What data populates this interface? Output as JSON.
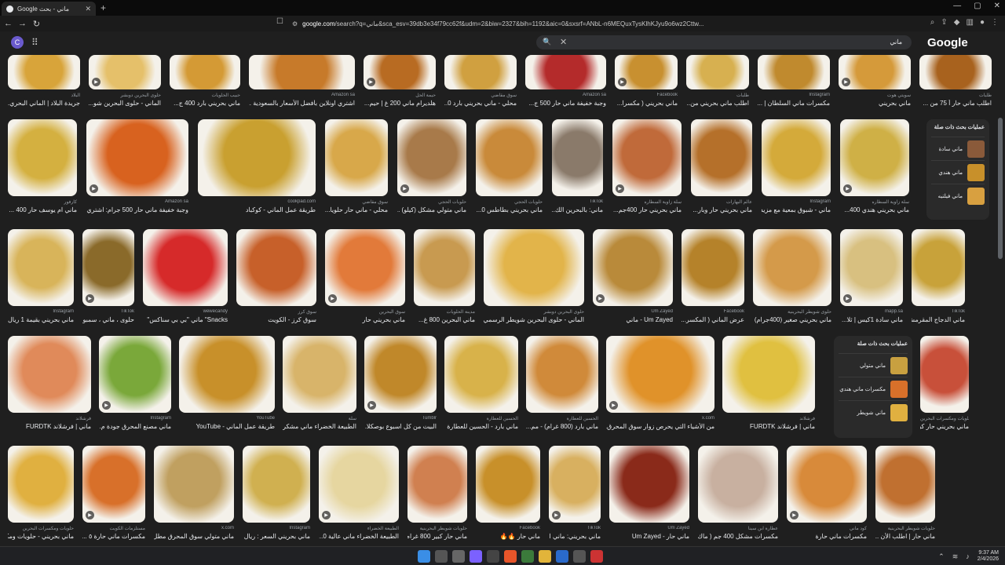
{
  "browser": {
    "tab_title": "ماني - بحث Google",
    "url_host": "google.com",
    "url_rest": "/search?q=ماني&sca_esv=39db3e34f79cc62f&udm=2&biw=2327&bih=1192&aic=0&sxsrf=ANbL-n6MEQuxTysKlhKJyu9o6wz2Cttw..."
  },
  "google": {
    "avatar_letter": "C",
    "query": "ماني",
    "logo_text": "Google"
  },
  "rows": [
    [
      {
        "title": "جريدة البلاد | الماني البحري...",
        "source": "البلاد",
        "color": "#d8a43a"
      },
      {
        "title": "الماني - حلوى البحرين شو...",
        "source": "حلوى البحرين دوبشر",
        "color": "#e5c06a"
      },
      {
        "title": "ماني بحريني بارد 400 ج...",
        "source": "حبيب الحلويات",
        "color": "#d49a35"
      },
      {
        "title": "اشتري اونلاين بأفضل الأسعار بالسعودية ...",
        "source": "Amazon sa",
        "color": "#c77a2a"
      },
      {
        "title": "هلديرام ماني 200 غ | حيم...",
        "source": "حيمة الحل",
        "color": "#b86b22"
      },
      {
        "title": "محلي - ماني بحريني بارد 0...",
        "source": "سوق مقاضي",
        "color": "#d0a040"
      },
      {
        "title": "وجبة خفيفة ماني حار 500 ج...",
        "source": "Amazon sa",
        "color": "#b42b2b"
      },
      {
        "title": "ماني بحريني ( مكسرا...",
        "source": "Facebook",
        "color": "#c89030"
      },
      {
        "title": "اطلب ماني بحريني من...",
        "source": "طلبات",
        "color": "#d7b050"
      },
      {
        "title": "مكسرات ماني السلطان | ...",
        "source": "Instagram",
        "color": "#c08a2e"
      },
      {
        "title": "ماني بحريني",
        "source": "سويتي هوت",
        "color": "#d59a3a"
      },
      {
        "title": "اطلب ماني حار أ 75 من ...",
        "source": "طلبات",
        "color": "#a8621e"
      }
    ],
    [
      {
        "title": "ماني ام يوسف حار 400 ...",
        "source": "كارفور",
        "color": "#d4b040"
      },
      {
        "title": "وجبة خفيفة ماني حار 500 جرام: اشتري...",
        "source": "Amazon sa",
        "color": "#d8621f"
      },
      {
        "title": "طريقة عمل الماني - كوكباد",
        "source": "cookpad.com",
        "color": "#c9a030"
      },
      {
        "title": "محلي - ماني حار حلويا...",
        "source": "سوق مقاضي",
        "color": "#d8a84a"
      },
      {
        "title": "ماني متولي مشكل (كيلو) ...",
        "source": "حلويات الحجي",
        "color": "#a87a4a"
      },
      {
        "title": "ماني بحريني بطاطس 0...",
        "source": "حلويات الحجي",
        "color": "#c98a3a"
      },
      {
        "title": "ماني: بالبحرين الك...",
        "source": "TikTok",
        "color": "#8a7a6a"
      },
      {
        "title": "ماني بحريني حار 400جم...",
        "source": "سلة زاوية السطاره",
        "color": "#c06a3a"
      },
      {
        "title": "ماني بحريني حار وبار...",
        "source": "عالم البهارات",
        "color": "#b5702a"
      },
      {
        "title": "ماني - شبوق بمعية مع مزيد",
        "source": "Instagram",
        "color": "#d4aa3a"
      },
      {
        "title": "ماني بحريني هندي 400...",
        "source": "سلة زاوية السطاره",
        "color": "#cfb046"
      }
    ],
    [
      {
        "title": "ماني بحريني بقيمة 1 ريال",
        "source": "Instagram",
        "color": "#d8b45a"
      },
      {
        "title": "حلوى ، ماني ، سمبوس...",
        "source": "TikTok",
        "color": "#8a6a2a"
      },
      {
        "title": "Snacks\" ماني \"بي بي سناكس\"",
        "source": "wewecandy",
        "color": "#d62a2a"
      },
      {
        "title": "سوق كرز - الكويت",
        "source": "سوق كرز",
        "color": "#c7602a"
      },
      {
        "title": "ماني بحريني حار",
        "source": "سوق البحرين",
        "color": "#e27a3a"
      },
      {
        "title": "ماني البحرين 800 غ...",
        "source": "مدينة الحلويات",
        "color": "#c89a50"
      },
      {
        "title": "الماني - حلوى البحرين شويطر الرسمي",
        "source": "حلوى البحرين دوبشر",
        "color": "#e2b44a"
      },
      {
        "title": "Um Zayed - ماني",
        "source": "Um Zayed",
        "color": "#b98a3a"
      },
      {
        "title": "عرض الماني ( المكسر...",
        "source": "Facebook",
        "color": "#b5822a"
      },
      {
        "title": "ماني بحريني صغير (400جرام)",
        "source": "حلوى شويطر البحرينية",
        "color": "#d49a4a"
      },
      {
        "title": "ماني سادة 1كيس | ثلا...",
        "source": "mapp.sa",
        "color": "#d8c080"
      },
      {
        "title": "ماني الدجاج المقرمش 1...",
        "source": "TikTok",
        "color": "#c8a23a"
      }
    ],
    [
      {
        "title": "ماني | فرشلاند FURDTK",
        "source": "فرشلاند",
        "color": "#e08a5a"
      },
      {
        "title": "ماني مصنع المحرق جودة م...",
        "source": "Instagram",
        "color": "#7aa83a"
      },
      {
        "title": "طريقة عمل الماني - YouTube",
        "source": "YouTube",
        "color": "#c8902a"
      },
      {
        "title": "الطبيعة الخضراء ماني مشكر...",
        "source": "سلة",
        "color": "#d8b46a"
      },
      {
        "title": "البيت من كل اسبوع بوصكلا...",
        "source": "Tumblr",
        "color": "#c0882a"
      },
      {
        "title": "ماني بارد - الحسين للعطارة",
        "source": "الحسين للعطارة",
        "color": "#d8b24a"
      },
      {
        "title": "ماني بارد (800 غرام) - مم...",
        "source": "الحسين للعطارة",
        "color": "#d08a3a"
      },
      {
        "title": "من الأشياء التي يحرص زوار سوق المحرق...",
        "source": "x.com",
        "color": "#e0922a"
      },
      {
        "title": "ماني | فرشلاند FURDTK",
        "source": "فرشلاند",
        "color": "#e0c040"
      },
      {
        "title": "ماني بحريني حار كبير م...",
        "source": "حلويات ومكسرات البحرين",
        "color": "#c8503a"
      }
    ],
    [
      {
        "title": "ماني بحريني - حلويات ومكسرا...",
        "source": "حلويات ومكسرات البحرين",
        "color": "#e0b040"
      },
      {
        "title": "مكسرات ماني حارة ٥ ...",
        "source": "مستلزمات الكويت",
        "color": "#d8702a"
      },
      {
        "title": "ماني متولي سوق المحرق مطل...",
        "source": "x.com",
        "color": "#c0a060"
      },
      {
        "title": "ماني بحريني السعر : ريال",
        "source": "Instagram",
        "color": "#d0b050"
      },
      {
        "title": "الطبيعة الخضراء ماني عالية 0...",
        "source": "الطبيعة الخضراء",
        "color": "#e6d6a0"
      },
      {
        "title": "ماني حار كبير 800 غرام - مم...",
        "source": "حلويات شويطر البحرينية",
        "color": "#d08050"
      },
      {
        "title": "ماني حار 🔥🔥",
        "source": "Facebook",
        "color": "#c8902a"
      },
      {
        "title": "ماني بحريني: ماني التولي لكو...",
        "source": "TikTok",
        "color": "#d8b060"
      },
      {
        "title": "ماني حار - Um Zayed",
        "source": "Um Zayed",
        "color": "#8a2a1a"
      },
      {
        "title": "مكسرات مشكل 400 جم ( ماك...",
        "source": "عطارة ابن سينا",
        "color": "#c8b0a0"
      },
      {
        "title": "مكسرات ماني حارة",
        "source": "كود ماني",
        "color": "#d88a3a"
      },
      {
        "title": "ماني حار | اطلب الأن ...",
        "source": "حلويات شويطر البحرينية",
        "color": "#c07030"
      }
    ]
  ],
  "related_1": {
    "heading": "عمليات بحث ذات صلة",
    "items": [
      {
        "label": "ماني سادة",
        "color": "#8a5a3a"
      },
      {
        "label": "ماني هندي",
        "color": "#c8902a"
      },
      {
        "label": "ماني فيلتيه",
        "color": "#d8a040"
      }
    ]
  },
  "related_2": {
    "heading": "عمليات بحث ذات صلة",
    "items": [
      {
        "label": "ماني متولي",
        "color": "#c8a040"
      },
      {
        "label": "مكسرات ماني هندي",
        "color": "#d8702a"
      },
      {
        "label": "ماني شويطر",
        "color": "#e0b040"
      }
    ]
  },
  "taskbar": {
    "time": "9:37 AM",
    "date": "2/4/2026"
  }
}
